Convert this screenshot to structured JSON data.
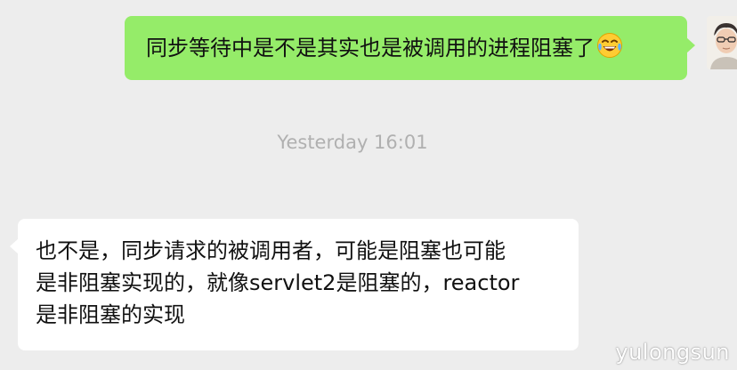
{
  "conversation": {
    "outgoing_message": {
      "text": "同步等待中是不是其实也是被调用的进程阻塞了",
      "emoji": "grinning-squinting-face-with-tears-icon"
    },
    "timestamp": "Yesterday 16:01",
    "incoming_message": {
      "lines": [
        "也不是，同步请求的被调用者，可能是阻塞也可能",
        "是非阻塞实现的，就像servlet2是阻塞的，reactor",
        "是非阻塞的实现"
      ]
    }
  },
  "colors": {
    "background": "#ededed",
    "outgoing_bubble": "#95ec69",
    "incoming_bubble": "#ffffff",
    "timestamp_text": "#b0b0b0"
  },
  "watermark": "yulongsun"
}
